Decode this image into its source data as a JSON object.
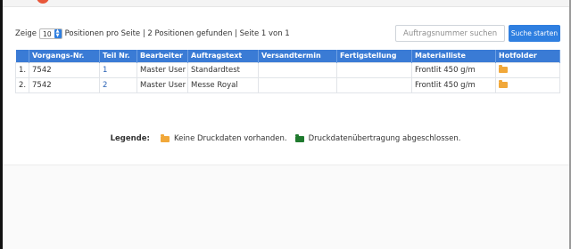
{
  "pager": {
    "prefix": "Zeige",
    "per_page": "10",
    "suffix": "Positionen pro Seite | 2 Positionen gefunden | Seite 1 von 1"
  },
  "search": {
    "placeholder": "Auftragsnummer suchen",
    "button_label": "Suche starten"
  },
  "table": {
    "headers": [
      "",
      "Vorgangs-Nr.",
      "Teil Nr.",
      "Bearbeiter",
      "Auftragstext",
      "Versandtermin",
      "Fertigstellung",
      "Materialliste",
      "Hotfolder"
    ],
    "rows": [
      {
        "index": "1.",
        "vorgang": "7542",
        "teil": "1",
        "bearbeiter": "Master User",
        "auftragstext": "Standardtest",
        "versandtermin": "",
        "fertigstellung": "",
        "material": "Frontlit 450 g/m",
        "hotfolder_icon": "folder-icon"
      },
      {
        "index": "2.",
        "vorgang": "7542",
        "teil": "2",
        "bearbeiter": "Master User",
        "auftragstext": "Messe Royal",
        "versandtermin": "",
        "fertigstellung": "",
        "material": "Frontlit 450 g/m",
        "hotfolder_icon": "folder-icon"
      }
    ]
  },
  "legend": {
    "title": "Legende:",
    "items": [
      {
        "icon": "folder-icon",
        "color": "#f1a83a",
        "label": "Keine Druckdaten vorhanden."
      },
      {
        "icon": "folder-open-icon",
        "color": "#1f7a2e",
        "label": "Druckdatenübertragung abgeschlossen."
      }
    ]
  },
  "colors": {
    "accent": "#2f7fe0",
    "table_header": "#3a7bd5",
    "logo": "#e8573a"
  }
}
